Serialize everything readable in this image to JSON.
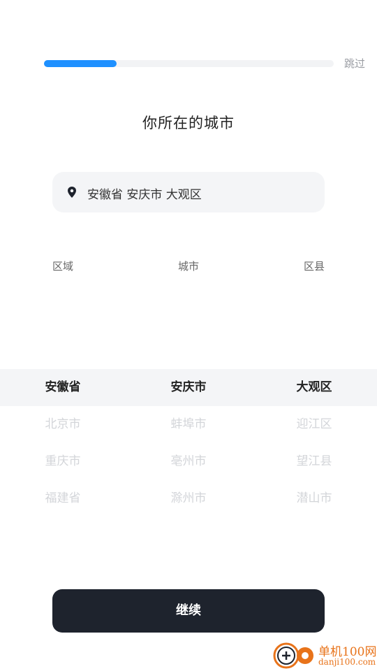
{
  "progress": {
    "value": 0.25
  },
  "header": {
    "skip_label": "跳过"
  },
  "title": "你所在的城市",
  "location": {
    "text": "安徽省 安庆市 大观区",
    "icon": "map-pin-icon"
  },
  "picker": {
    "headers": [
      "区域",
      "城市",
      "区县"
    ],
    "columns": [
      {
        "selected": "安徽省",
        "options": [
          "北京市",
          "重庆市",
          "福建省"
        ]
      },
      {
        "selected": "安庆市",
        "options": [
          "蚌埠市",
          "亳州市",
          "滁州市"
        ]
      },
      {
        "selected": "大观区",
        "options": [
          "迎江区",
          "望江县",
          "潜山市"
        ]
      }
    ]
  },
  "continue_label": "继续",
  "watermark": {
    "name": "单机100网",
    "url": "danji100.com"
  },
  "colors": {
    "accent": "#1e90ff",
    "button": "#1e232d",
    "watermark": "#e8731a"
  }
}
